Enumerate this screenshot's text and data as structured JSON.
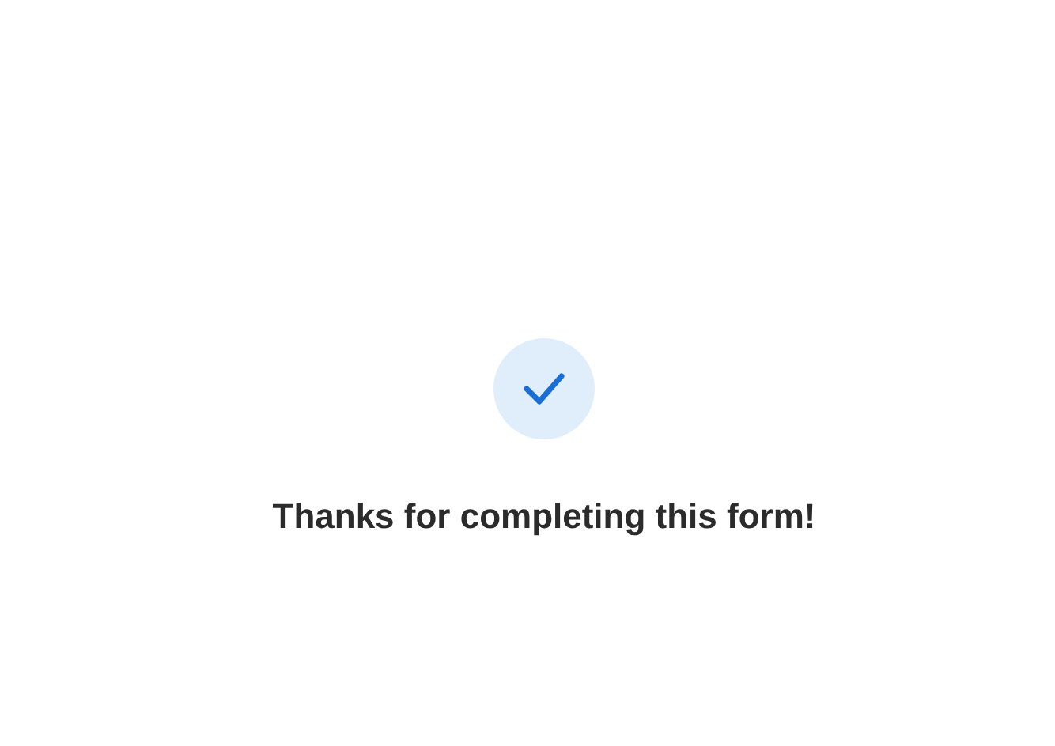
{
  "message": {
    "title": "Thanks for completing this form!"
  }
}
